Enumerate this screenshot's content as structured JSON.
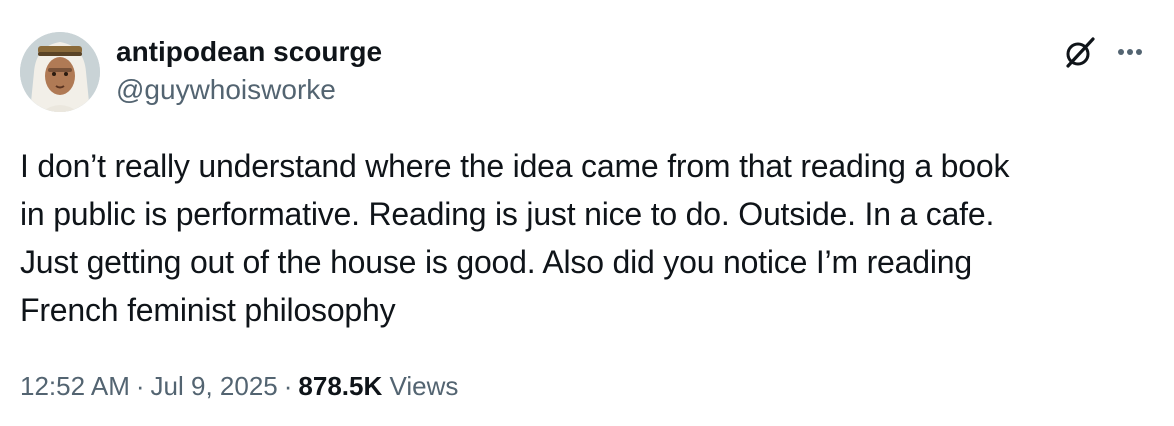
{
  "author": {
    "display_name": "antipodean scourge",
    "handle": "@guywhoisworke"
  },
  "actions": {
    "grok_icon": "grok-icon",
    "more_icon": "more-horizontal-icon"
  },
  "tweet": {
    "text": "I don’t really understand where the idea came from that reading a book\nin public is performative. Reading is just nice to do. Outside. In a cafe.\nJust getting out of the house is good. Also did you notice I’m reading\nFrench feminist philosophy"
  },
  "meta": {
    "time": "12:52 AM",
    "separator": "·",
    "date": "Jul 9, 2025",
    "views_count": "878.5K",
    "views_label": "Views"
  },
  "colors": {
    "text_primary": "#0f1419",
    "text_secondary": "#536471",
    "background": "#ffffff"
  }
}
